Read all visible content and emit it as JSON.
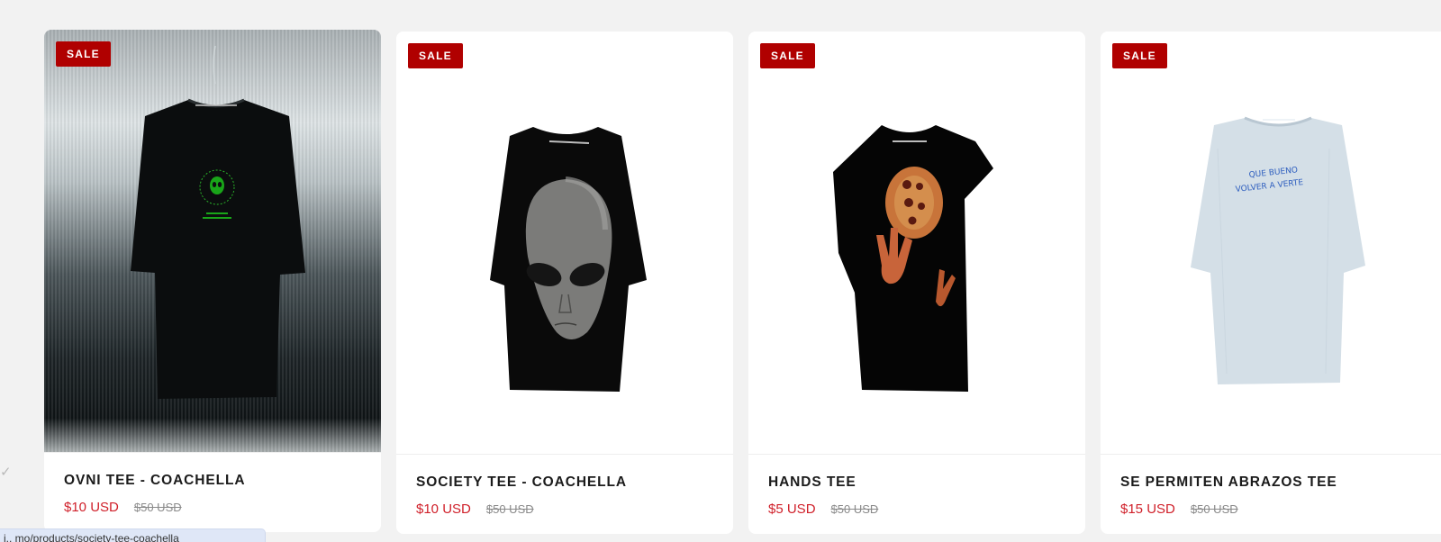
{
  "products": [
    {
      "badge": "SALE",
      "title": "OVNI TEE - COACHELLA",
      "price": "$10 USD",
      "compare_price": "$50 USD",
      "image": "black-tee-green-alien-logo-photo"
    },
    {
      "badge": "SALE",
      "title": "SOCIETY TEE - COACHELLA",
      "price": "$10 USD",
      "compare_price": "$50 USD",
      "image": "black-tee-alien-face-print"
    },
    {
      "badge": "SALE",
      "title": "HANDS TEE",
      "price": "$5 USD",
      "compare_price": "$50 USD",
      "image": "black-tee-hands-print"
    },
    {
      "badge": "SALE",
      "title": "SE PERMITEN ABRAZOS TEE",
      "price": "$15 USD",
      "compare_price": "$50 USD",
      "image": "light-blue-tee-text-print"
    }
  ],
  "shirt_prints": {
    "white_tee_text_line1": "QUE BUENO",
    "white_tee_text_line2": "VOLVER A VERTE"
  },
  "status_bar": {
    "url": "i.. mo/products/society-tee-coachella"
  },
  "colors": {
    "sale_badge": "#b00000",
    "price": "#d0202a",
    "compare_price": "#8a8a8a"
  }
}
